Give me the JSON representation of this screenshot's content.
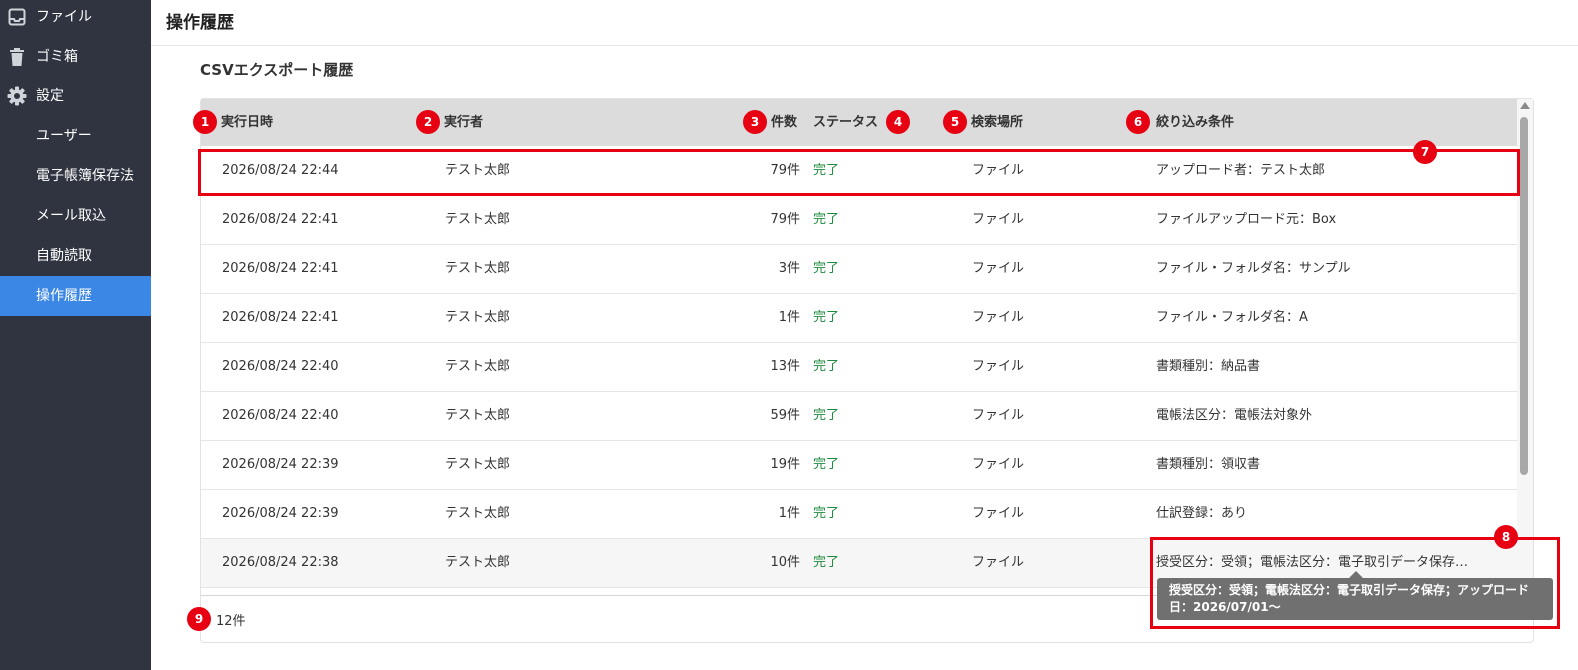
{
  "sidebar": {
    "items": [
      {
        "label": "ファイル",
        "icon": "inbox-icon"
      },
      {
        "label": "ゴミ箱",
        "icon": "trash-icon"
      },
      {
        "label": "設定",
        "icon": "gear-icon"
      },
      {
        "label": "ユーザー"
      },
      {
        "label": "電子帳簿保存法"
      },
      {
        "label": "メール取込"
      },
      {
        "label": "自動読取"
      },
      {
        "label": "操作履歴",
        "active": true
      }
    ]
  },
  "page": {
    "title": "操作履歴"
  },
  "section": {
    "title": "CSVエクスポート履歴"
  },
  "table": {
    "headers": {
      "date": "実行日時",
      "user": "実行者",
      "count": "件数",
      "status": "ステータス",
      "place": "検索場所",
      "condition": "絞り込み条件"
    },
    "rows": [
      {
        "date": "2026/08/24 22:44",
        "user": "テスト太郎",
        "count": "79件",
        "status": "完了",
        "place": "ファイル",
        "condition": "アップロード者：テスト太郎"
      },
      {
        "date": "2026/08/24 22:41",
        "user": "テスト太郎",
        "count": "79件",
        "status": "完了",
        "place": "ファイル",
        "condition": "ファイルアップロード元：Box"
      },
      {
        "date": "2026/08/24 22:41",
        "user": "テスト太郎",
        "count": "3件",
        "status": "完了",
        "place": "ファイル",
        "condition": "ファイル・フォルダ名：サンプル"
      },
      {
        "date": "2026/08/24 22:41",
        "user": "テスト太郎",
        "count": "1件",
        "status": "完了",
        "place": "ファイル",
        "condition": "ファイル・フォルダ名：A"
      },
      {
        "date": "2026/08/24 22:40",
        "user": "テスト太郎",
        "count": "13件",
        "status": "完了",
        "place": "ファイル",
        "condition": "書類種別：納品書"
      },
      {
        "date": "2026/08/24 22:40",
        "user": "テスト太郎",
        "count": "59件",
        "status": "完了",
        "place": "ファイル",
        "condition": "電帳法区分：電帳法対象外"
      },
      {
        "date": "2026/08/24 22:39",
        "user": "テスト太郎",
        "count": "19件",
        "status": "完了",
        "place": "ファイル",
        "condition": "書類種別：領収書"
      },
      {
        "date": "2026/08/24 22:39",
        "user": "テスト太郎",
        "count": "1件",
        "status": "完了",
        "place": "ファイル",
        "condition": "仕訳登録：あり"
      },
      {
        "date": "2026/08/24 22:38",
        "user": "テスト太郎",
        "count": "10件",
        "status": "完了",
        "place": "ファイル",
        "condition": "授受区分：受領；電帳法区分：電子取引データ保存…"
      }
    ],
    "total": "12件"
  },
  "tooltip": {
    "line1": "授受区分：受領；電帳法区分：電子取引データ保存；アップロード",
    "line2": "日：2026/07/01～"
  },
  "markers": [
    "1",
    "2",
    "3",
    "4",
    "5",
    "6",
    "7",
    "8",
    "9"
  ],
  "colors": {
    "sidebar_bg": "#2f3440",
    "active_nav": "#3b87e6",
    "status_done": "#1e8a3e",
    "marker_red": "#e60012",
    "header_bg": "#dcdcdc"
  }
}
